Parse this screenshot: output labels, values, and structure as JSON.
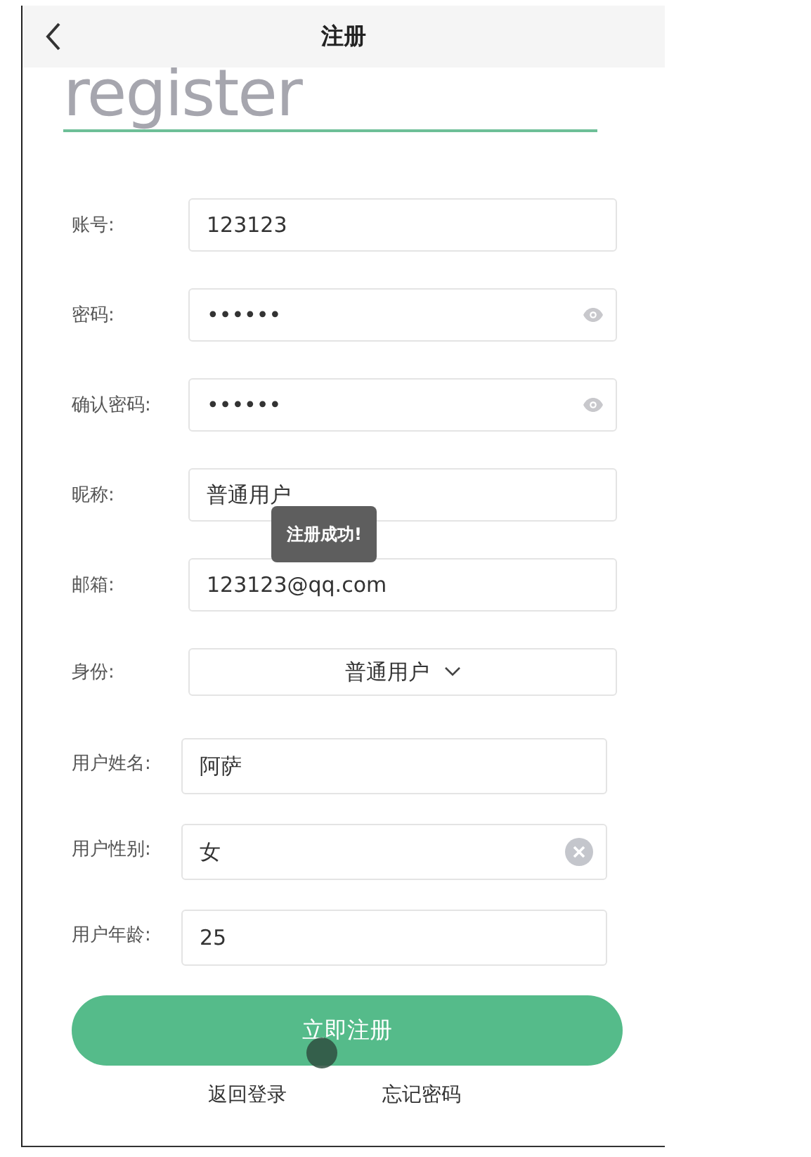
{
  "header": {
    "title": "注册"
  },
  "heading": "register",
  "fields": [
    {
      "label": "账号:",
      "kind": "text",
      "value": "123123"
    },
    {
      "label": "密码:",
      "kind": "password",
      "value": "••••••"
    },
    {
      "label": "确认密码:",
      "kind": "password",
      "value": "••••••"
    },
    {
      "label": "昵称:",
      "kind": "text",
      "value": "普通用户"
    },
    {
      "label": "邮箱:",
      "kind": "text",
      "value": "123123@qq.com"
    },
    {
      "label": "身份:",
      "kind": "select",
      "value": "普通用户"
    }
  ],
  "user_fields": [
    {
      "label": "用户姓名:",
      "kind": "text",
      "value": "阿萨"
    },
    {
      "label": "用户性别:",
      "kind": "clearable",
      "value": "女"
    },
    {
      "label": "用户年龄:",
      "kind": "text",
      "value": "25"
    }
  ],
  "submit": "立即注册",
  "links": [
    "返回登录",
    "忘记密码"
  ],
  "toast": "注册成功!"
}
